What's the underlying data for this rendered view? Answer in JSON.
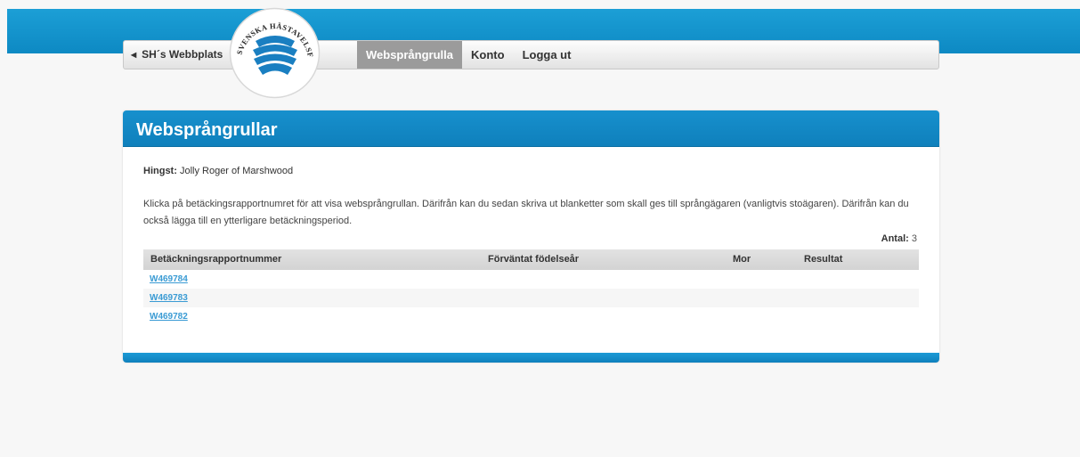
{
  "nav": {
    "back_label": "SH´s Webbplats",
    "items": [
      {
        "label": "Websprångrulla"
      },
      {
        "label": "Konto"
      },
      {
        "label": "Logga ut"
      }
    ]
  },
  "logo": {
    "text_top": "SVENSKA HÄSTAVELSFÖRBUNDET"
  },
  "panel": {
    "title": "Websprångrullar",
    "horse_label": "Hingst:",
    "horse_name": "Jolly Roger of Marshwood",
    "info": "Klicka på betäckingsrapportnumret för att visa websprångrullan. Därifrån kan du sedan skriva ut blanketter som skall ges till språngägaren (vanligtvis stoägaren). Därifrån kan du också lägga till en ytterligare betäckningsperiod.",
    "count_label": "Antal:",
    "count_value": "3"
  },
  "table": {
    "headers": {
      "col1": "Betäckningsrapportnummer",
      "col2": "Förväntat födelseår",
      "col3": "Mor",
      "col4": "Resultat"
    },
    "rows": [
      {
        "number": "W469784"
      },
      {
        "number": "W469783"
      },
      {
        "number": "W469782"
      }
    ]
  },
  "colors": {
    "brand_blue": "#0f80bc",
    "link": "#3a9bd4",
    "active_tab": "#9b9b9b"
  }
}
